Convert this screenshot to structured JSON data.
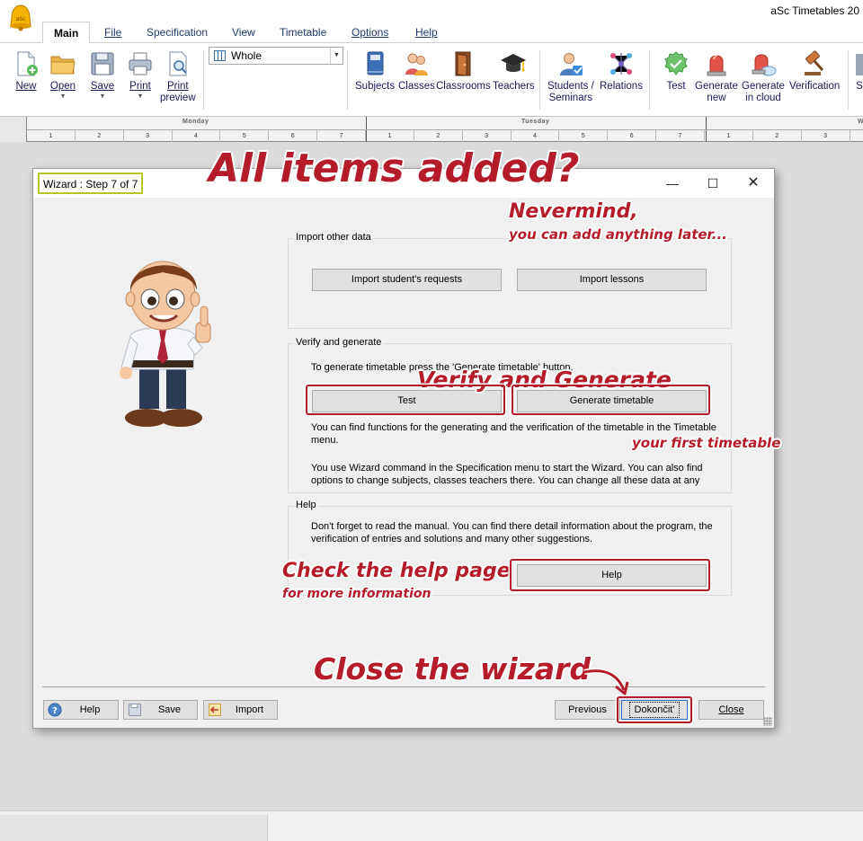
{
  "app": {
    "title": "aSc Timetables 20"
  },
  "tabs": [
    "Main",
    "File",
    "Specification",
    "View",
    "Timetable",
    "Options",
    "Help"
  ],
  "ribbon": {
    "new": "New",
    "open": "Open",
    "save": "Save",
    "print": "Print",
    "print_preview_1": "Print",
    "print_preview_2": "preview",
    "view_select": "Whole",
    "subjects": "Subjects",
    "classes": "Classes",
    "classrooms": "Classrooms",
    "teachers": "Teachers",
    "students_1": "Students /",
    "students_2": "Seminars",
    "relations": "Relations",
    "test": "Test",
    "gen_new_1": "Generate",
    "gen_new_2": "new",
    "gen_cloud_1": "Generate",
    "gen_cloud_2": "in cloud",
    "verification": "Verification",
    "cut_label": "S"
  },
  "timetable": {
    "days": [
      "Monday",
      "Tuesday",
      "W"
    ],
    "periods": [
      "1",
      "2",
      "3",
      "4",
      "5",
      "6",
      "7"
    ]
  },
  "wizard": {
    "title": "Wizard : Step 7 of 7",
    "import_group": {
      "title": "Import other data",
      "btn_requests": "Import student's requests",
      "btn_lessons": "Import lessons"
    },
    "verify_group": {
      "title": "Verify and generate",
      "text1": "To generate timetable press the 'Generate timetable' button.",
      "btn_test": "Test",
      "btn_generate": "Generate timetable",
      "text2a": "You can find functions for the generating and the verification of the timetable in the Timetable",
      "text2b": "menu.",
      "text3a": "You use Wizard command in the Specification menu to start the Wizard. You can also find",
      "text3b": "options to change subjects, classes teachers there. You can change all these data at any"
    },
    "help_group": {
      "title": "Help",
      "text1a": "Don't forget to read the manual. You can find there detail information about the program, the",
      "text1b": "verification of entries and solutions and many other suggestions.",
      "btn_help": "Help"
    },
    "footer": {
      "help": "Help",
      "save": "Save",
      "import": "Import",
      "previous": "Previous",
      "finish": "Dokončit'",
      "close": "Close"
    }
  },
  "annotations": {
    "all_items": "All items added?",
    "nevermind_1": "Nevermind,",
    "nevermind_2": "you can add anything later...",
    "verify": "Verify and Generate",
    "first_tt": "your first timetable",
    "check_help_1": "Check the help page",
    "check_help_2": "for more information",
    "close_wizard": "Close the wizard"
  },
  "colors": {
    "annotation": "#b51c2a",
    "title_highlight": "#b9c81d",
    "ribbon_text": "#1a1a5a"
  }
}
